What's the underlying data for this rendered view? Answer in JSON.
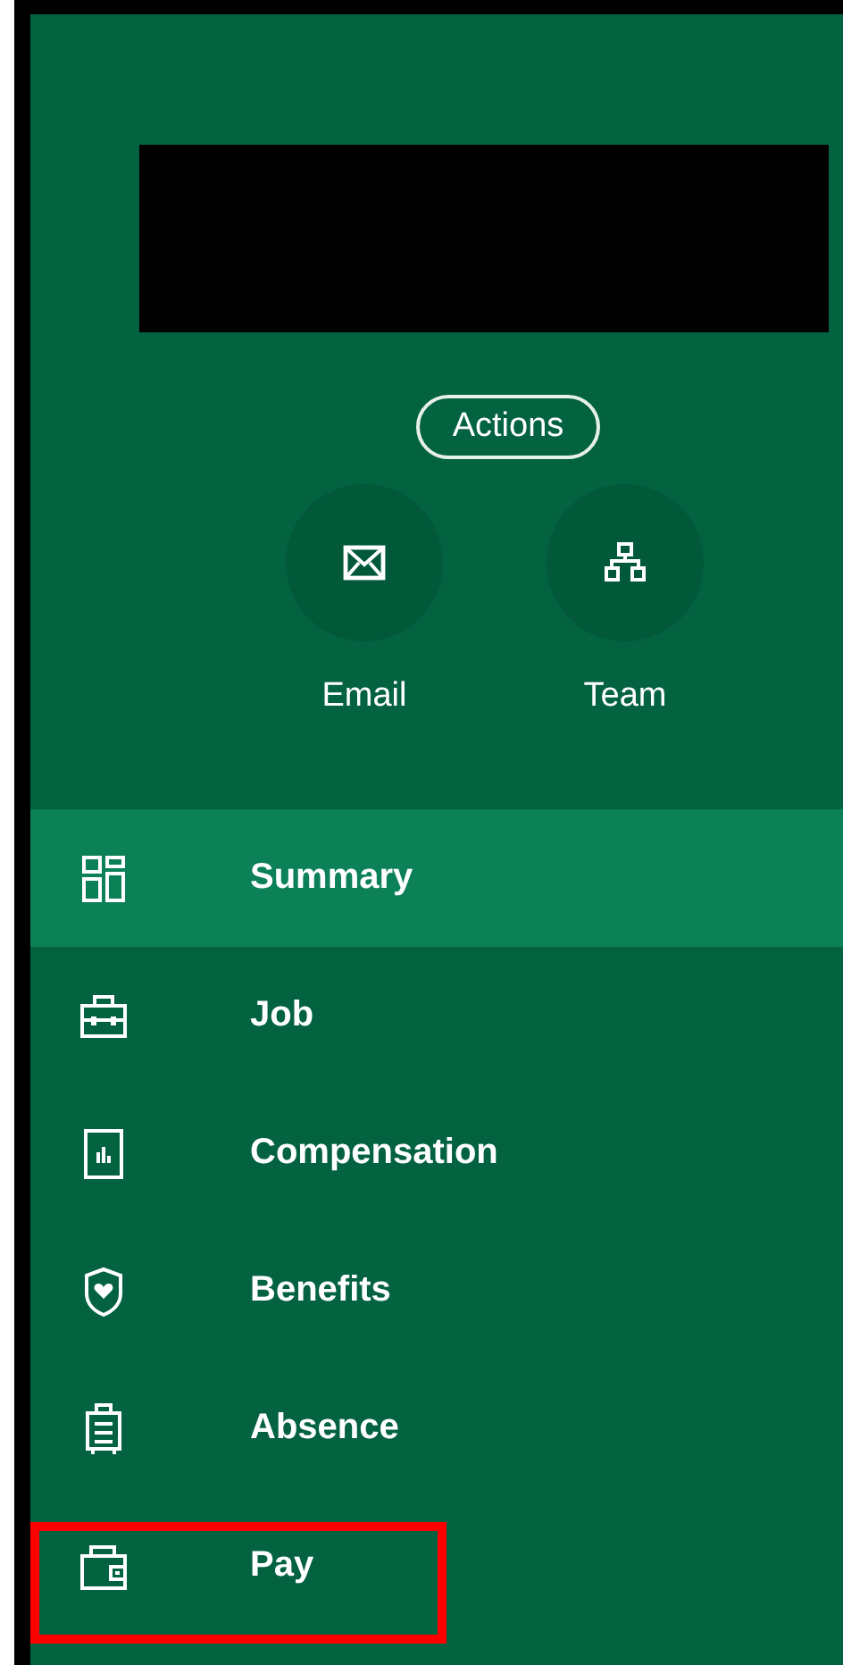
{
  "header": {
    "name_redacted": true
  },
  "actions_button": {
    "label": "Actions"
  },
  "quick_links": [
    {
      "kind": "email",
      "label": "Email"
    },
    {
      "kind": "team",
      "label": "Team"
    }
  ],
  "menu": [
    {
      "kind": "summary",
      "label": "Summary",
      "selected": true,
      "highlighted": false
    },
    {
      "kind": "job",
      "label": "Job",
      "selected": false,
      "highlighted": false
    },
    {
      "kind": "compensation",
      "label": "Compensation",
      "selected": false,
      "highlighted": false
    },
    {
      "kind": "benefits",
      "label": "Benefits",
      "selected": false,
      "highlighted": false
    },
    {
      "kind": "absence",
      "label": "Absence",
      "selected": false,
      "highlighted": false
    },
    {
      "kind": "pay",
      "label": "Pay",
      "selected": false,
      "highlighted": true
    }
  ]
}
